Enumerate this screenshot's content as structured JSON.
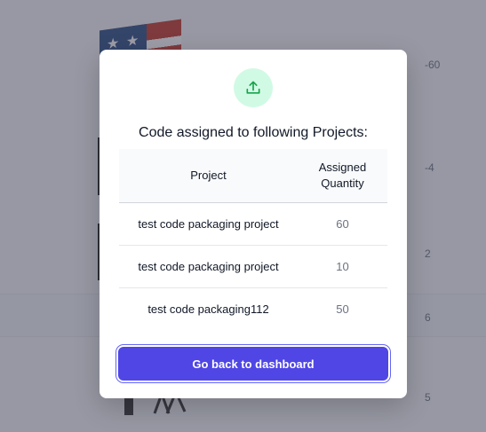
{
  "background": {
    "numbers": [
      "-60",
      "-4",
      "2",
      "6",
      "5"
    ]
  },
  "modal": {
    "title": "Code assigned to following Projects:",
    "icon": "upload-icon",
    "accent_color": "#4f46e5",
    "icon_bg_color": "#d1fae5",
    "icon_color": "#16a34a",
    "table": {
      "headers": {
        "project": "Project",
        "quantity_line1": "Assigned",
        "quantity_line2": "Quantity"
      },
      "rows": [
        {
          "project": "test code packaging project",
          "quantity": "60"
        },
        {
          "project": "test code packaging project",
          "quantity": "10"
        },
        {
          "project": "test code packaging112",
          "quantity": "50"
        }
      ]
    },
    "button_label": "Go back to dashboard"
  }
}
